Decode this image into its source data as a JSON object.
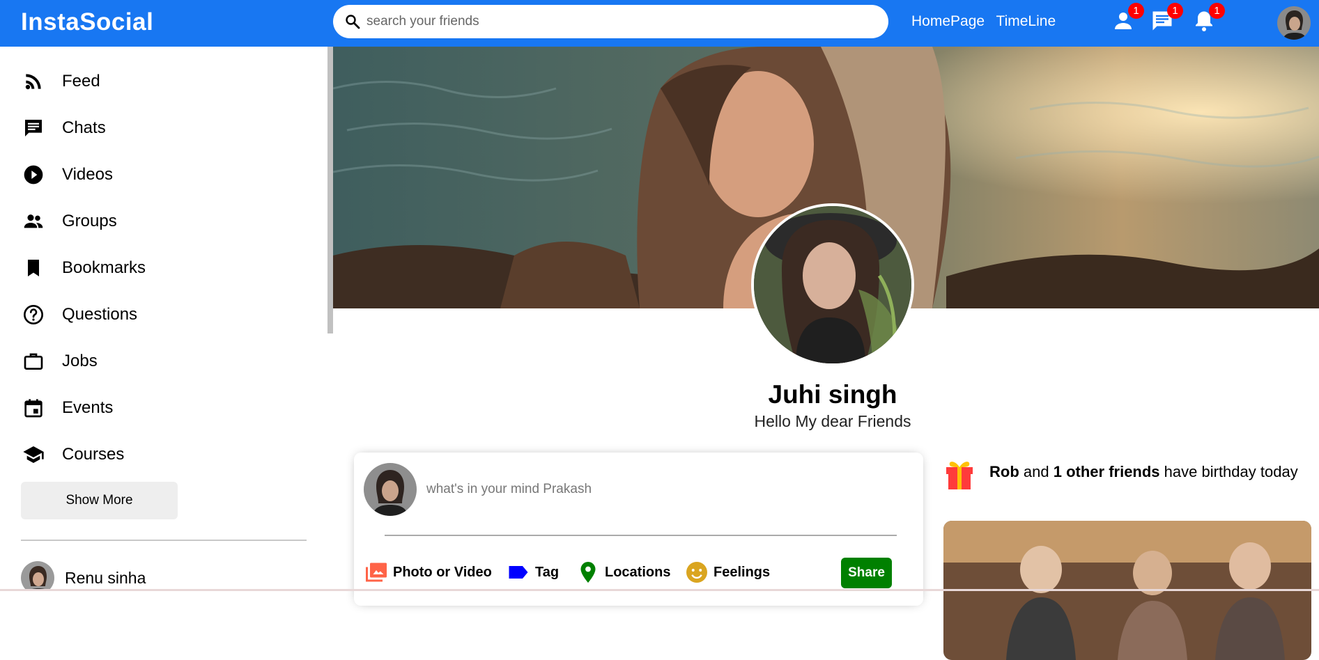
{
  "topbar": {
    "logo": "InstaSocial",
    "search_placeholder": "search your friends",
    "links": [
      "HomePage",
      "TimeLine"
    ],
    "badges": {
      "friends": "1",
      "messages": "1",
      "notifications": "1"
    },
    "color": "#1877f2"
  },
  "sidebar": {
    "items": [
      {
        "label": "Feed",
        "icon": "rss-feed-icon"
      },
      {
        "label": "Chats",
        "icon": "chat-icon"
      },
      {
        "label": "Videos",
        "icon": "play-circle-icon"
      },
      {
        "label": "Groups",
        "icon": "group-icon"
      },
      {
        "label": "Bookmarks",
        "icon": "bookmark-icon"
      },
      {
        "label": "Questions",
        "icon": "help-circle-icon"
      },
      {
        "label": "Jobs",
        "icon": "briefcase-icon"
      },
      {
        "label": "Events",
        "icon": "calendar-icon"
      },
      {
        "label": "Courses",
        "icon": "graduation-cap-icon"
      }
    ],
    "show_more": "Show More",
    "friends": [
      {
        "name": "Renu sinha"
      }
    ]
  },
  "profile": {
    "name": "Juhi singh",
    "description": "Hello My dear Friends"
  },
  "share": {
    "placeholder": "what's in your mind Prakash",
    "options": [
      "Photo or Video",
      "Tag",
      "Locations",
      "Feelings"
    ],
    "option_colors": [
      "#ff6347",
      "#0000ff",
      "#008000",
      "#daa520"
    ],
    "button": "Share"
  },
  "birthday": {
    "name": "Rob",
    "mid": "and",
    "others": "1 other friends",
    "tail": "have birthday today"
  }
}
